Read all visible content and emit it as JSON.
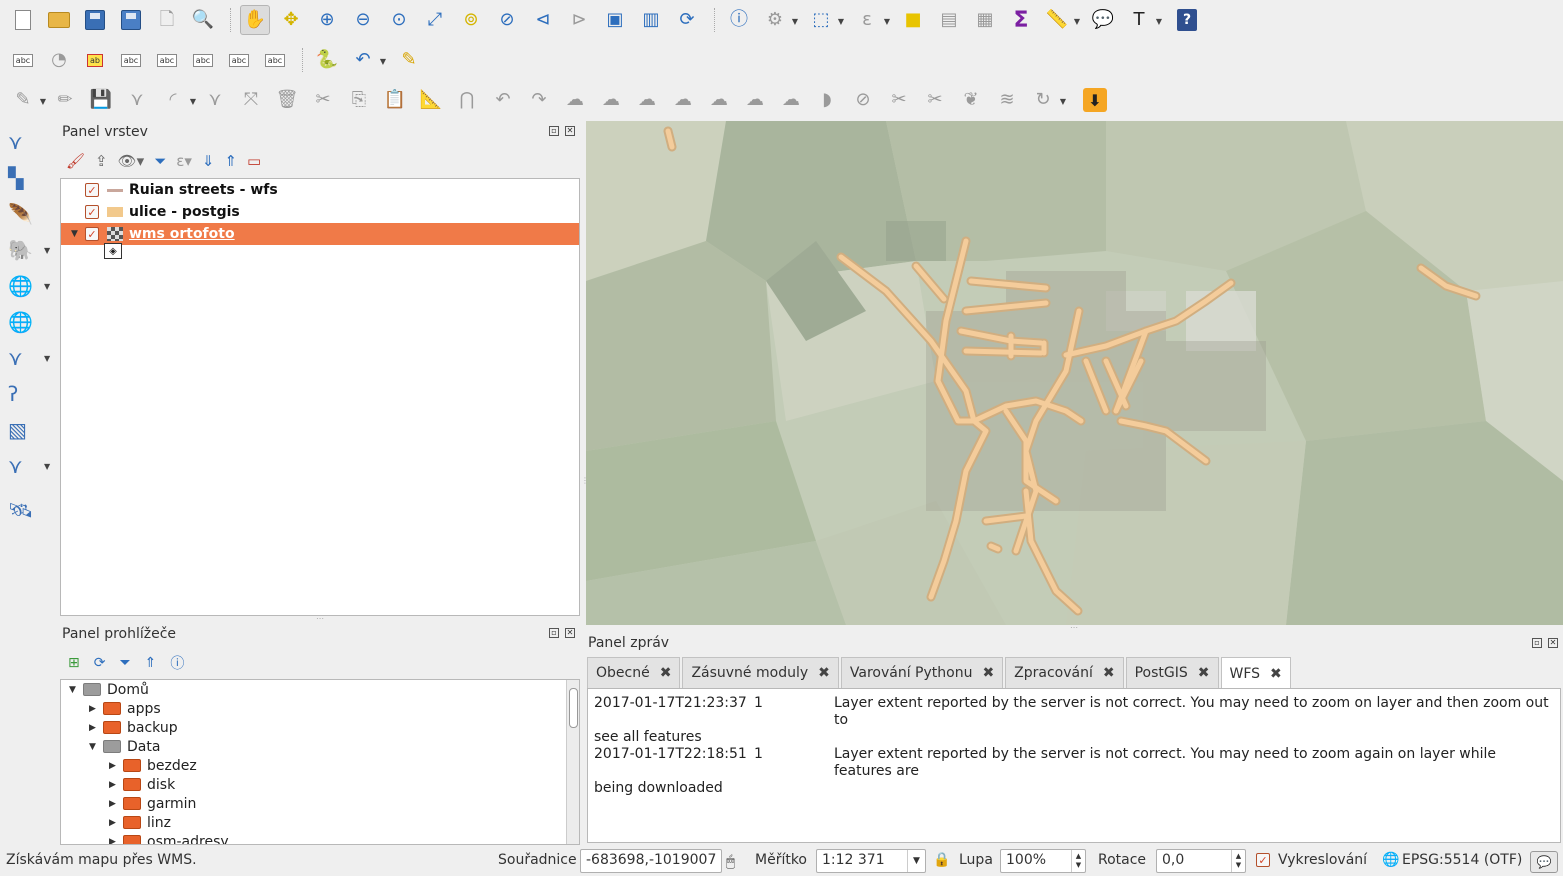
{
  "colors": {
    "selected_layer": "#f07a48",
    "street_line": "#f0c080",
    "street_outline": "#c9a06a",
    "map_background": "#bcc5b0"
  },
  "toolbar_rows": {
    "row1_icons": [
      "new-project-icon",
      "open-project-icon",
      "save-project-icon",
      "save-as-icon",
      "new-print-layout-icon",
      "layout-manager-icon",
      "pan-icon",
      "pan-to-selection-icon",
      "zoom-in-icon",
      "zoom-out-icon",
      "zoom-native-icon",
      "zoom-full-icon",
      "zoom-to-selection-icon",
      "zoom-to-layer-icon",
      "zoom-last-icon",
      "zoom-next-icon",
      "new-map-view-icon",
      "bookmarks-icon",
      "refresh-icon",
      "identify-icon",
      "measure-select-icon",
      "select-features-icon",
      "select-expression-icon",
      "deselect-icon",
      "attribute-table-icon",
      "field-calculator-icon",
      "statistics-icon",
      "measure-icon",
      "annotation-icon",
      "text-annotation-icon",
      "help-icon"
    ],
    "row2_icons": [
      "label-toolbar-icon",
      "diagram-icon",
      "highlight-label-icon",
      "pin-label-icon",
      "show-hide-label-icon",
      "move-label-icon",
      "rotate-label-icon",
      "change-label-icon",
      "python-console-icon",
      "undo-plugin-icon",
      "digitize-plugin-icon"
    ],
    "row3_icons": [
      "current-edits-icon",
      "toggle-editing-icon",
      "save-edits-icon",
      "add-feature-icon",
      "add-circular-icon",
      "node-tool-icon",
      "move-feature-icon",
      "delete-selected-icon",
      "cut-features-icon",
      "copy-features-icon",
      "paste-features-icon",
      "snapping-icon",
      "magnet-icon",
      "undo-icon",
      "redo-icon",
      "simplify-icon",
      "add-ring-icon",
      "add-part-icon",
      "fill-ring-icon",
      "delete-ring-icon",
      "delete-part-icon",
      "reshape-icon",
      "offset-curve-icon",
      "split-features-icon",
      "split-parts-icon",
      "merge-features-icon",
      "merge-attributes-icon",
      "rotate-point-icon",
      "download-icon"
    ]
  },
  "layers_panel": {
    "title": "Panel vrstev",
    "layers": [
      {
        "name": "Ruian streets - wfs",
        "checked": true,
        "symbol": "line",
        "selected": false
      },
      {
        "name": "ulice - postgis",
        "checked": true,
        "symbol": "fill",
        "selected": false
      },
      {
        "name": "wms ortofoto",
        "checked": true,
        "symbol": "raster",
        "selected": true
      }
    ]
  },
  "browser_panel": {
    "title": "Panel prohlížeče",
    "items": [
      {
        "label": "Domů",
        "level": 0,
        "expanded": true,
        "folder": "gray"
      },
      {
        "label": "apps",
        "level": 1,
        "expanded": false,
        "folder": "orange"
      },
      {
        "label": "backup",
        "level": 1,
        "expanded": false,
        "folder": "orange"
      },
      {
        "label": "Data",
        "level": 1,
        "expanded": true,
        "folder": "gray"
      },
      {
        "label": "bezdez",
        "level": 2,
        "expanded": false,
        "folder": "orange"
      },
      {
        "label": "disk",
        "level": 2,
        "expanded": false,
        "folder": "orange"
      },
      {
        "label": "garmin",
        "level": 2,
        "expanded": false,
        "folder": "orange"
      },
      {
        "label": "linz",
        "level": 2,
        "expanded": false,
        "folder": "orange"
      },
      {
        "label": "osm-adresy",
        "level": 2,
        "expanded": false,
        "folder": "orange"
      }
    ]
  },
  "messages_panel": {
    "title": "Panel zpráv",
    "tabs": [
      {
        "label": "Obecné",
        "active": false
      },
      {
        "label": "Zásuvné moduly",
        "active": false
      },
      {
        "label": "Varování Pythonu",
        "active": false
      },
      {
        "label": "Zpracování",
        "active": false
      },
      {
        "label": "PostGIS",
        "active": false
      },
      {
        "label": "WFS",
        "active": true
      }
    ],
    "messages": [
      {
        "time": "2017-01-17T21:23:37",
        "level": "1",
        "text": "Layer extent reported by the server is not correct. You may need to zoom on layer and then zoom out to",
        "cont": "see all features"
      },
      {
        "time": "2017-01-17T22:18:51",
        "level": "1",
        "text": "Layer extent reported by the server is not correct. You may need to zoom again on layer while features are",
        "cont": "being downloaded"
      }
    ]
  },
  "statusbar": {
    "message": "Získávám mapu přes WMS.",
    "coord_label": "Souřadnice",
    "coord_value": "-683698,-1019007",
    "scale_label": "Měřítko",
    "scale_value": "1:12 371",
    "magnifier_label": "Lupa",
    "magnifier_value": "100%",
    "rotation_label": "Rotace",
    "rotation_value": "0,0",
    "render_label": "Vykreslování",
    "render_checked": true,
    "crs_label": "EPSG:5514 (OTF)"
  }
}
